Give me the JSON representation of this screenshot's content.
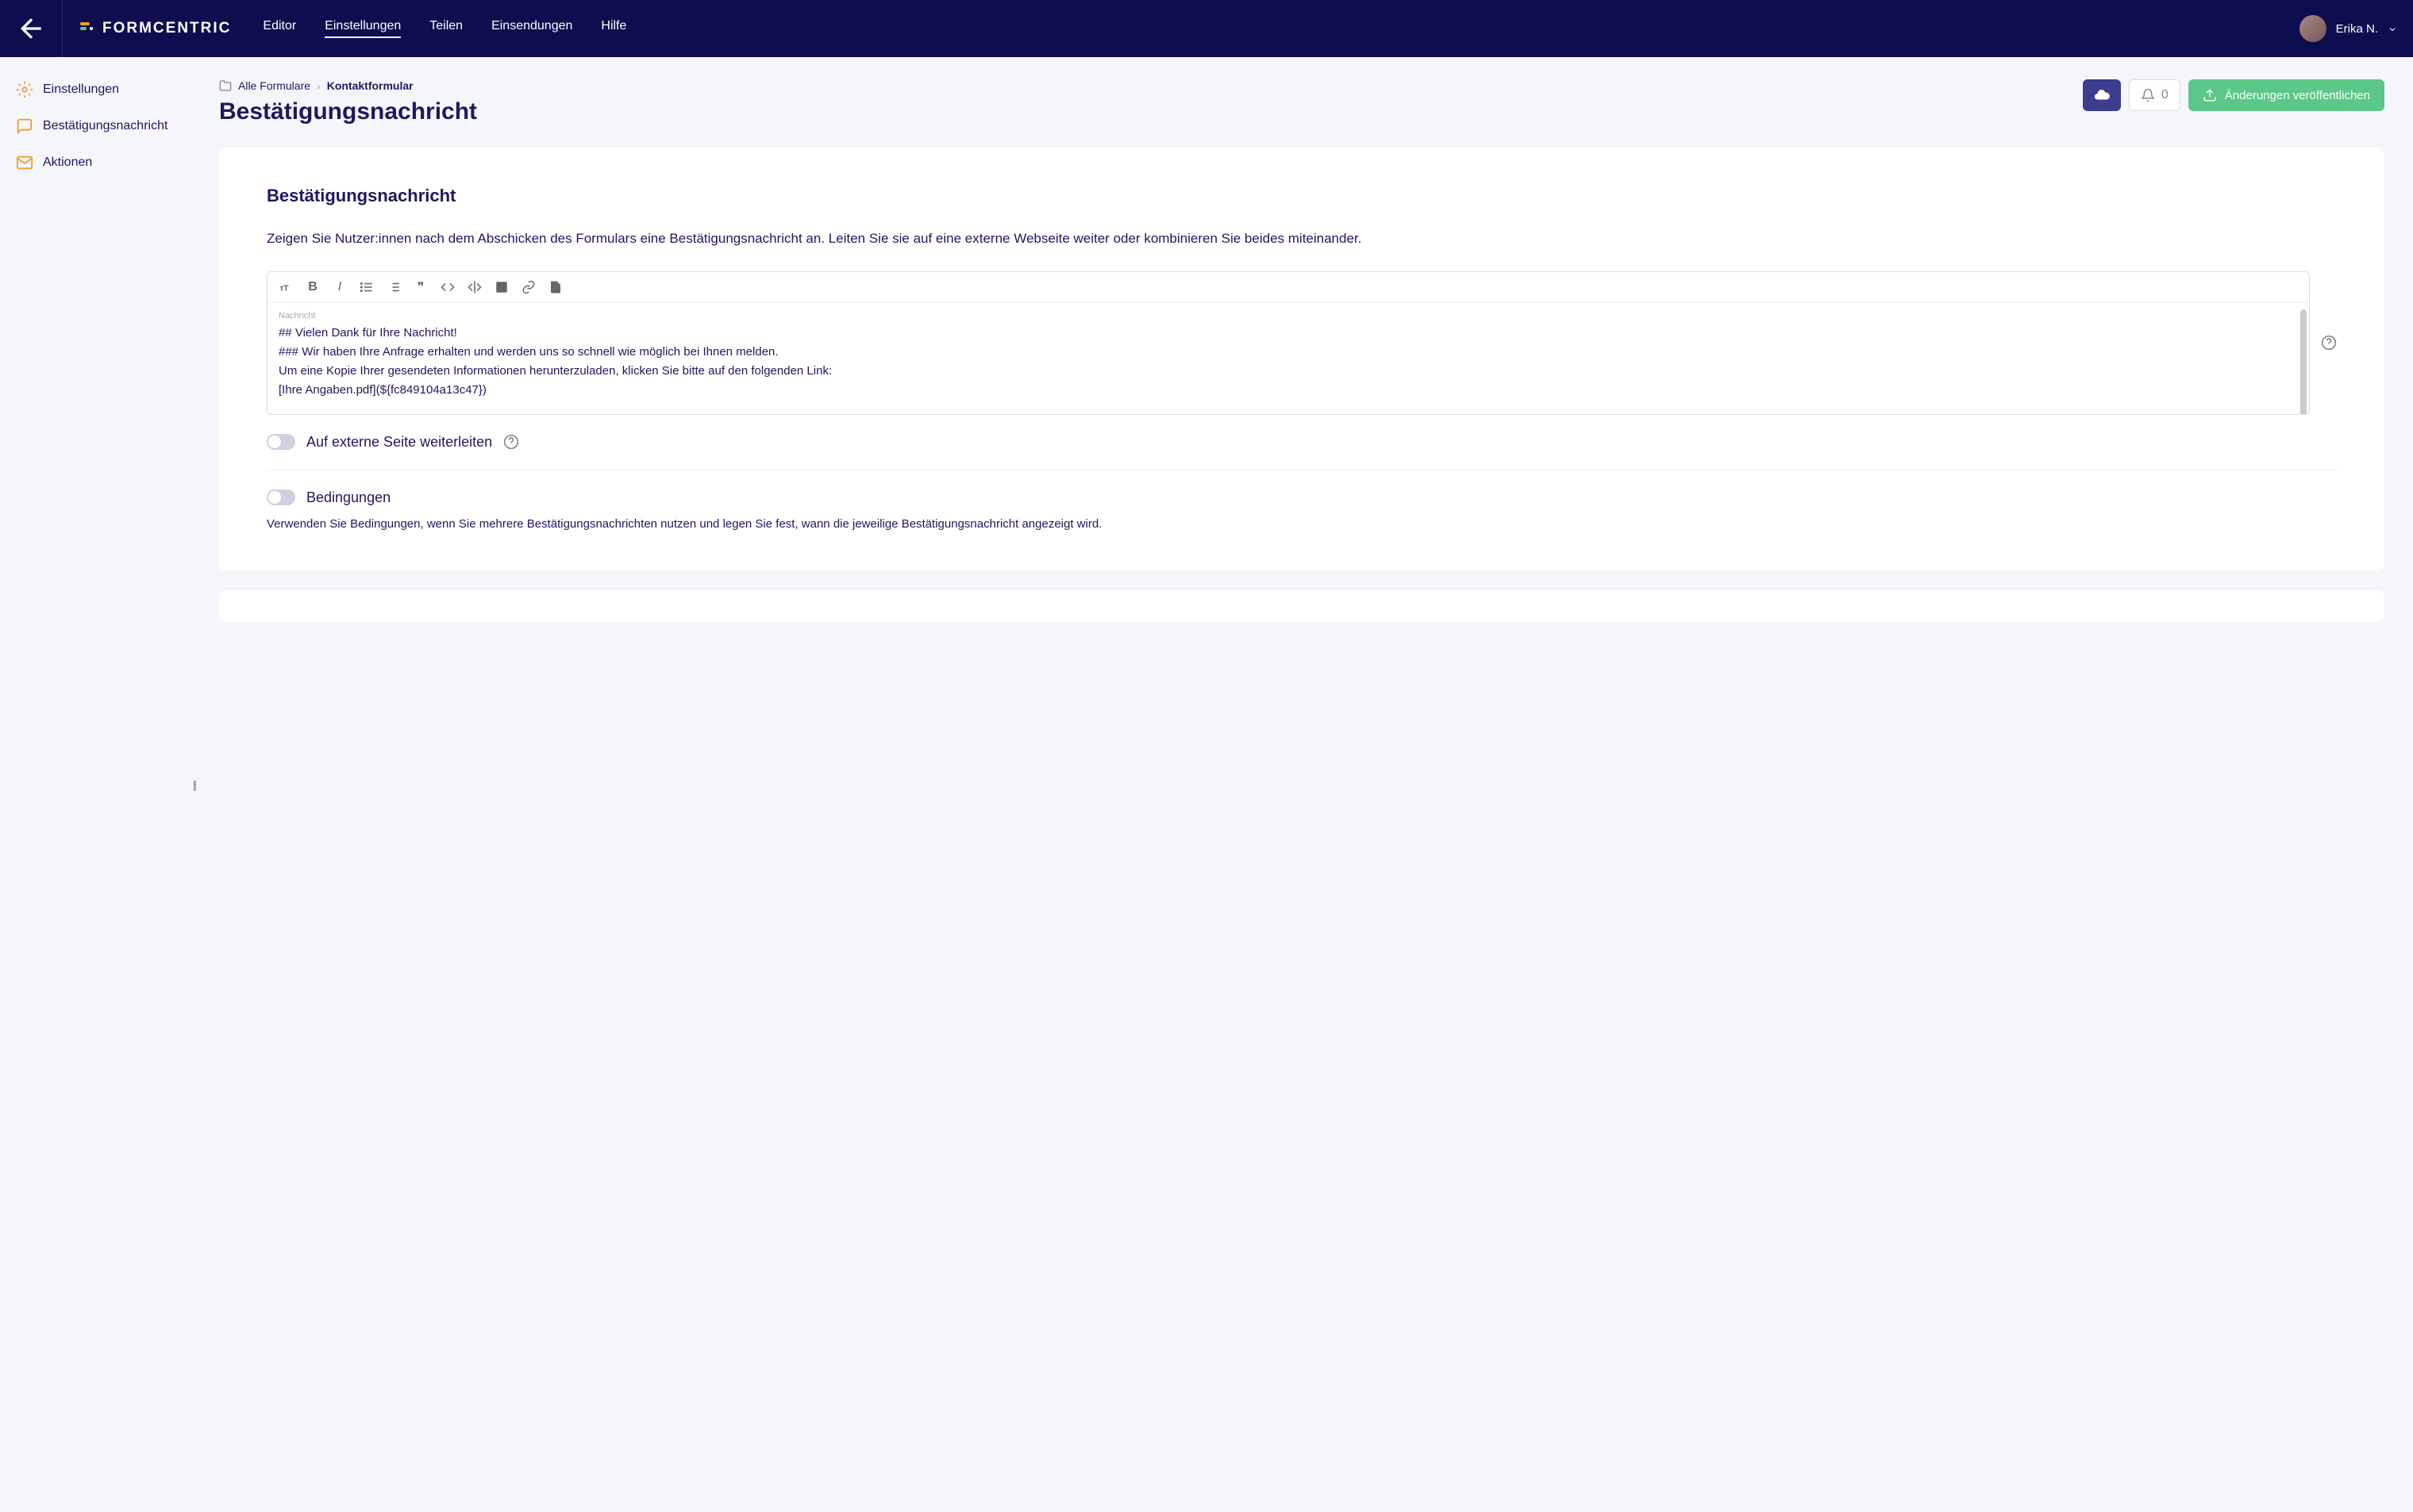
{
  "header": {
    "logo_text": "FORMCENTRIC",
    "nav": [
      "Editor",
      "Einstellungen",
      "Teilen",
      "Einsendungen",
      "Hilfe"
    ],
    "active_nav": 1,
    "user_name": "Erika N."
  },
  "sidebar": {
    "items": [
      {
        "label": "Einstellungen",
        "icon": "gear"
      },
      {
        "label": "Bestätigungsnachricht",
        "icon": "message"
      },
      {
        "label": "Aktionen",
        "icon": "mail"
      }
    ]
  },
  "breadcrumb": {
    "root": "Alle Formulare",
    "current": "Kontaktformular"
  },
  "page_title": "Bestätigungsnachricht",
  "actions": {
    "notif_count": "0",
    "publish_label": "Änderungen veröffentlichen"
  },
  "card": {
    "title": "Bestätigungsnachricht",
    "desc": "Zeigen Sie Nutzer:innen nach dem Abschicken des Formulars eine Bestätigungsnachricht an. Leiten Sie sie auf eine externe Webseite weiter oder kombinieren Sie beides miteinander.",
    "editor_label": "Nachricht",
    "editor_lines": [
      "## Vielen Dank für Ihre Nachricht!",
      "### Wir haben Ihre Anfrage erhalten und werden uns so schnell wie möglich bei Ihnen melden.",
      "",
      "Um eine Kopie Ihrer gesendeten Informationen herunterzuladen, klicken Sie bitte auf den folgenden Link:",
      "[Ihre Angaben.pdf](${fc849104a13c47})"
    ],
    "redirect_label": "Auf externe Seite weiterleiten",
    "conditions_label": "Bedingungen",
    "conditions_desc": "Verwenden Sie Bedingungen, wenn Sie mehrere Bestätigungsnachrichten nutzen und legen Sie fest, wann die jeweilige Bestätigungsnachricht angezeigt wird."
  }
}
